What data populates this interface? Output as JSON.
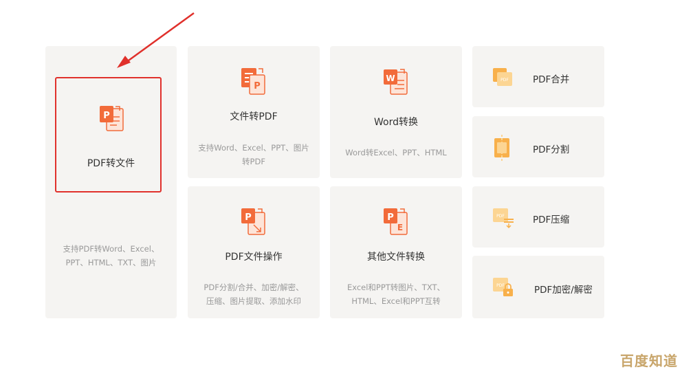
{
  "cards": {
    "pdf_to_file": {
      "title": "PDF转文件",
      "desc_line1": "支持PDF转Word、Excel、",
      "desc_line2": "PPT、HTML、TXT、图片",
      "icon": "pdf-to-file-icon"
    },
    "file_to_pdf": {
      "title": "文件转PDF",
      "desc_line1": "支持Word、Excel、PPT、图片",
      "desc_line2": "转PDF",
      "icon": "file-to-pdf-icon"
    },
    "word_convert": {
      "title": "Word转换",
      "desc_line1": "Word转Excel、PPT、HTML",
      "icon": "word-convert-icon"
    },
    "pdf_operations": {
      "title": "PDF文件操作",
      "desc_line1": "PDF分割/合并、加密/解密、",
      "desc_line2": "压缩、图片提取、添加水印",
      "icon": "pdf-operations-icon"
    },
    "other_convert": {
      "title": "其他文件转换",
      "desc_line1": "Excel和PPT转图片、TXT、",
      "desc_line2": "HTML、Excel和PPT互转",
      "icon": "other-convert-icon"
    }
  },
  "tools": [
    {
      "label": "PDF合并",
      "icon": "pdf-merge-icon"
    },
    {
      "label": "PDF分割",
      "icon": "pdf-split-icon"
    },
    {
      "label": "PDF压缩",
      "icon": "pdf-compress-icon"
    },
    {
      "label": "PDF加密/解密",
      "icon": "pdf-encrypt-icon"
    }
  ],
  "icon_badge_pdf": "PDF",
  "watermark": "百度知道",
  "colors": {
    "accent": "#f26b3a",
    "card_bg": "#f5f4f2",
    "highlight": "#e0302b",
    "tool_icon": "#f8b04b"
  }
}
